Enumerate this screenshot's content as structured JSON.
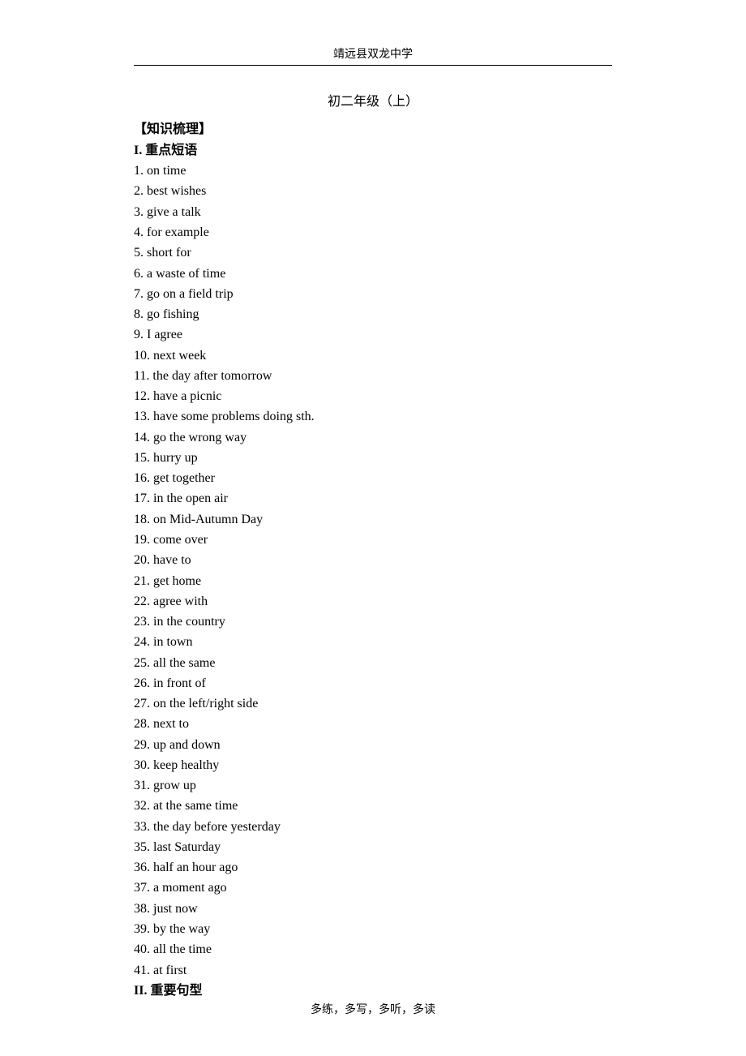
{
  "header": "靖远县双龙中学",
  "title": "初二年级（上）",
  "section_label": "【知识梳理】",
  "subheading_1": "I. 重点短语",
  "items": [
    "1. on time",
    "2. best wishes",
    "3. give a talk",
    "4. for example",
    "5. short for",
    "6. a waste of time",
    "7. go on a field trip",
    "8. go fishing",
    "9. I agree",
    "10. next week",
    "11. the day after tomorrow",
    "12. have a picnic",
    "13. have some problems doing sth.",
    "14. go the wrong way",
    "15. hurry up",
    "16. get together",
    "17. in the open air",
    "18. on Mid-Autumn Day",
    "19. come over",
    "20. have to",
    "21. get home",
    "22. agree with",
    "23. in the country",
    "24. in town",
    "25. all the same",
    "26. in front of",
    "27. on the left/right side",
    "28. next to",
    "29. up and down",
    "30. keep healthy",
    "31. grow up",
    "32. at the same time",
    "33. the day before yesterday",
    "35. last Saturday",
    "36. half an hour ago",
    "37. a moment ago",
    "38. just now",
    "39. by the way",
    "40. all the time",
    "41. at first"
  ],
  "subheading_2": "II. 重要句型",
  "footer": "多练，多写，多听，多读"
}
